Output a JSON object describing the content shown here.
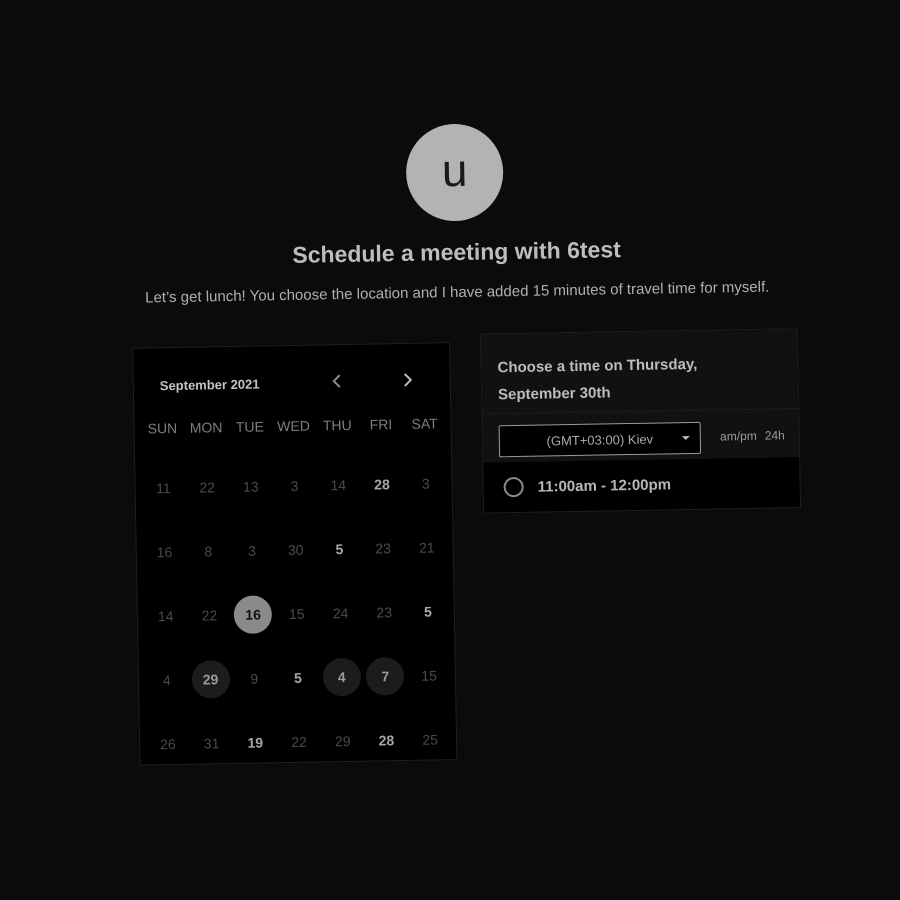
{
  "avatar": {
    "letter": "u"
  },
  "header": {
    "title": "Schedule a meeting with 6test",
    "subtitle": "Let’s get lunch! You choose the location and I have added 15 minutes of travel time for myself."
  },
  "calendar": {
    "month_label": "September 2021",
    "prev_icon": "chevron-left-icon",
    "next_icon": "chevron-right-icon",
    "weekdays": [
      "SUN",
      "MON",
      "TUE",
      "WED",
      "THU",
      "FRI",
      "SAT"
    ],
    "weeks": [
      [
        {
          "n": "11",
          "s": "dim"
        },
        {
          "n": "22",
          "s": "dim"
        },
        {
          "n": "13",
          "s": "dim"
        },
        {
          "n": "3",
          "s": "dim"
        },
        {
          "n": "14",
          "s": "dim"
        },
        {
          "n": "28",
          "s": "avail"
        },
        {
          "n": "3",
          "s": "dim"
        }
      ],
      [
        {
          "n": "16",
          "s": "dim"
        },
        {
          "n": "8",
          "s": "dim"
        },
        {
          "n": "3",
          "s": "dim"
        },
        {
          "n": "30",
          "s": "dim"
        },
        {
          "n": "5",
          "s": "avail"
        },
        {
          "n": "23",
          "s": "dim"
        },
        {
          "n": "21",
          "s": "dim"
        }
      ],
      [
        {
          "n": "14",
          "s": "dim"
        },
        {
          "n": "22",
          "s": "dim"
        },
        {
          "n": "16",
          "s": "selected"
        },
        {
          "n": "15",
          "s": "dim"
        },
        {
          "n": "24",
          "s": "dim"
        },
        {
          "n": "23",
          "s": "dim"
        },
        {
          "n": "5",
          "s": "avail"
        }
      ],
      [
        {
          "n": "4",
          "s": "dim"
        },
        {
          "n": "29",
          "s": "bubble"
        },
        {
          "n": "9",
          "s": "dim"
        },
        {
          "n": "5",
          "s": "avail"
        },
        {
          "n": "4",
          "s": "bubble"
        },
        {
          "n": "7",
          "s": "bubble"
        },
        {
          "n": "15",
          "s": "dim"
        }
      ],
      [
        {
          "n": "26",
          "s": "dim"
        },
        {
          "n": "31",
          "s": "dim"
        },
        {
          "n": "19",
          "s": "avail"
        },
        {
          "n": "22",
          "s": "dim"
        },
        {
          "n": "29",
          "s": "dim"
        },
        {
          "n": "28",
          "s": "avail"
        },
        {
          "n": "25",
          "s": "dim"
        }
      ]
    ]
  },
  "timepanel": {
    "title": "Choose a time on Thursday, September 30th",
    "timezone": "(GMT+03:00) Kiev",
    "format_ampm": "am/pm",
    "format_24h": "24h",
    "slots": [
      "11:00am - 12:00pm"
    ]
  },
  "colors": {
    "background": "#0b0b0b",
    "panel": "#000000",
    "panel_header": "#111111",
    "avatar": "#b3b3b3",
    "selected_day": "#8a8a8a"
  }
}
